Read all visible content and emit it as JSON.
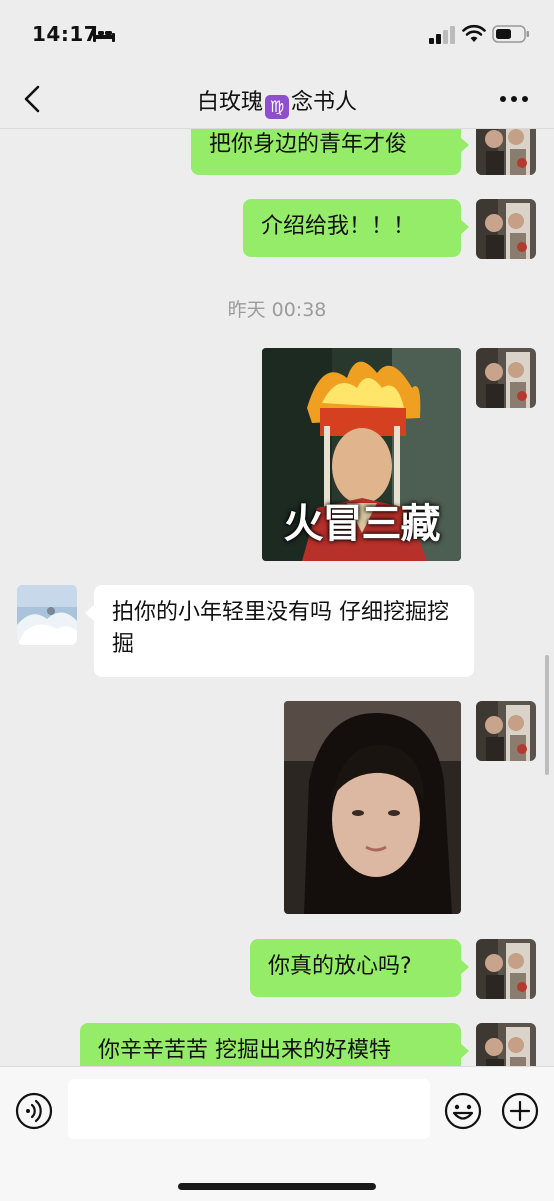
{
  "status_bar": {
    "time": "14:17"
  },
  "header": {
    "title_before": "白玫瑰",
    "virgo_symbol": "♍",
    "title_after": "念书人"
  },
  "messages": {
    "m1": "把你身边的青年才俊",
    "m2": "介绍给我！！！",
    "timestamp": "昨天 00:38",
    "sticker_caption": "火冒三藏",
    "m3": "拍你的小年轻里没有吗 仔细挖掘挖掘",
    "m4": "你真的放心吗?",
    "m5": "你辛辛苦苦 挖掘出来的好模特"
  },
  "input": {
    "placeholder": ""
  },
  "icons": {
    "back": "chevron-left-icon",
    "more": "ellipsis-icon",
    "voice": "voice-icon",
    "emoji": "emoji-icon",
    "plus": "plus-icon"
  },
  "colors": {
    "bubble_me": "#95ec69",
    "bubble_other": "#ffffff",
    "background": "#ededed",
    "virgo_badge": "#8e4fcf"
  }
}
